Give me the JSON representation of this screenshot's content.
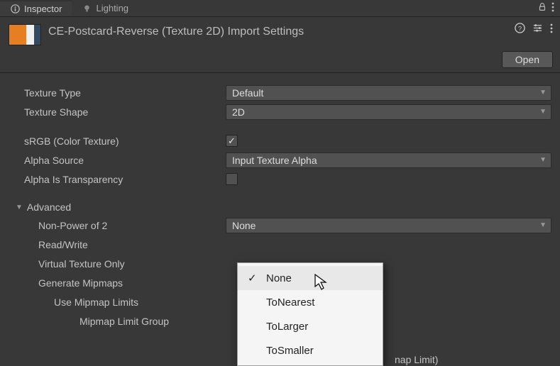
{
  "tabs": {
    "inspector": "Inspector",
    "lighting": "Lighting"
  },
  "header": {
    "title": "CE-Postcard-Reverse (Texture 2D) Import Settings",
    "open_button": "Open"
  },
  "fields": {
    "texture_type": {
      "label": "Texture Type",
      "value": "Default"
    },
    "texture_shape": {
      "label": "Texture Shape",
      "value": "2D"
    },
    "srgb": {
      "label": "sRGB (Color Texture)",
      "checked": true
    },
    "alpha_source": {
      "label": "Alpha Source",
      "value": "Input Texture Alpha"
    },
    "alpha_is_transparency": {
      "label": "Alpha Is Transparency",
      "checked": false
    },
    "advanced": {
      "label": "Advanced"
    },
    "non_power_of_2": {
      "label": "Non-Power of 2",
      "value": "None"
    },
    "read_write": {
      "label": "Read/Write"
    },
    "virtual_texture_only": {
      "label": "Virtual Texture Only"
    },
    "generate_mipmaps": {
      "label": "Generate Mipmaps"
    },
    "use_mipmap_limits": {
      "label": "Use Mipmap Limits"
    },
    "mipmap_limit_group": {
      "label": "Mipmap Limit Group",
      "value_suffix": "nap Limit)"
    }
  },
  "popup": {
    "items": [
      "None",
      "ToNearest",
      "ToLarger",
      "ToSmaller"
    ],
    "selected": "None"
  },
  "icons": {
    "info": "info-icon",
    "light": "light-icon",
    "lock": "lock-icon",
    "more": "more-icon",
    "help": "help-icon",
    "sliders": "sliders-icon"
  }
}
